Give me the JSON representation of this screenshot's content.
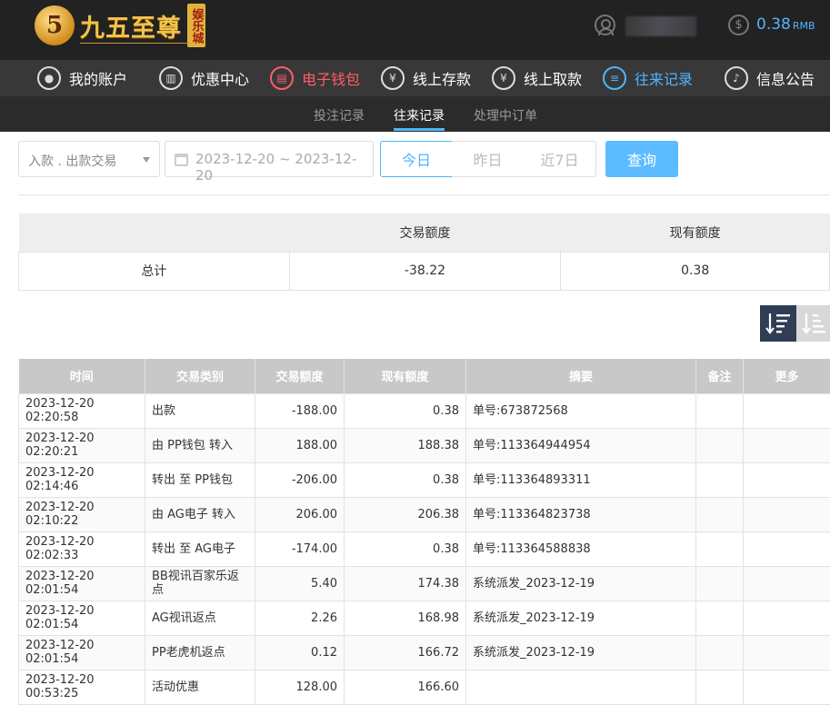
{
  "brand": {
    "badge": "5",
    "name": "九五至尊",
    "tag": "娱乐城"
  },
  "account": {
    "balance": "0.38",
    "currency": "RMB"
  },
  "main_nav": [
    {
      "label": "我的账户",
      "icon": "user-icon"
    },
    {
      "label": "优惠中心",
      "icon": "gift-icon"
    },
    {
      "label": "电子钱包",
      "icon": "wallet-icon"
    },
    {
      "label": "线上存款",
      "icon": "deposit-icon"
    },
    {
      "label": "线上取款",
      "icon": "withdraw-icon"
    },
    {
      "label": "往来记录",
      "icon": "records-icon"
    },
    {
      "label": "信息公告",
      "icon": "bell-icon"
    }
  ],
  "sub_nav": [
    "投注记录",
    "往来记录",
    "处理中订单"
  ],
  "filter": {
    "type_value": "入款 . 出款交易",
    "date_range": "2023-12-20 ~ 2023-12-20",
    "quick": [
      "今日",
      "昨日",
      "近7日"
    ],
    "search_label": "查询"
  },
  "summary": {
    "headers": [
      "",
      "交易额度",
      "现有额度"
    ],
    "row": [
      "总计",
      "-38.22",
      "0.38"
    ]
  },
  "records": {
    "headers": [
      "时间",
      "交易类别",
      "交易额度",
      "现有额度",
      "摘要",
      "备注",
      "更多"
    ],
    "rows": [
      [
        "2023-12-20 02:20:58",
        "出款",
        "-188.00",
        "0.38",
        "单号:673872568",
        "",
        ""
      ],
      [
        "2023-12-20 02:20:21",
        "由 PP钱包 转入",
        "188.00",
        "188.38",
        "单号:113364944954",
        "",
        ""
      ],
      [
        "2023-12-20 02:14:46",
        "转出 至 PP钱包",
        "-206.00",
        "0.38",
        "单号:113364893311",
        "",
        ""
      ],
      [
        "2023-12-20 02:10:22",
        "由 AG电子 转入",
        "206.00",
        "206.38",
        "单号:113364823738",
        "",
        ""
      ],
      [
        "2023-12-20 02:02:33",
        "转出 至 AG电子",
        "-174.00",
        "0.38",
        "单号:113364588838",
        "",
        ""
      ],
      [
        "2023-12-20 02:01:54",
        "BB视讯百家乐返点",
        "5.40",
        "174.38",
        "系统派发_2023-12-19",
        "",
        ""
      ],
      [
        "2023-12-20 02:01:54",
        "AG视讯返点",
        "2.26",
        "168.98",
        "系统派发_2023-12-19",
        "",
        ""
      ],
      [
        "2023-12-20 02:01:54",
        "PP老虎机返点",
        "0.12",
        "166.72",
        "系统派发_2023-12-19",
        "",
        ""
      ],
      [
        "2023-12-20 00:53:25",
        "活动优惠",
        "128.00",
        "166.60",
        "",
        "",
        ""
      ]
    ]
  },
  "colors": {
    "accent": "#4fb5ff",
    "active_red": "#ff5d6a",
    "header_bg": "#222222",
    "nav_bg": "#383838"
  }
}
